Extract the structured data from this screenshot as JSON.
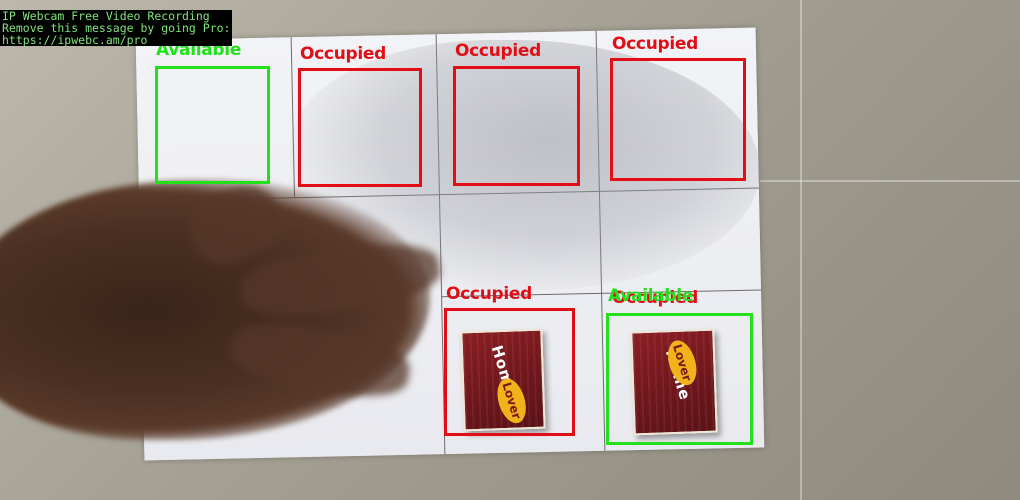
{
  "watermark": {
    "line1": "IP Webcam Free Video Recording",
    "line2": "Remove this message by going Pro:",
    "line3": "https://ipwebc.am/pro"
  },
  "slots": [
    {
      "id": "slot-1",
      "status": "available",
      "label": "Available"
    },
    {
      "id": "slot-2",
      "status": "occupied",
      "label": "Occupied"
    },
    {
      "id": "slot-3",
      "status": "occupied",
      "label": "Occupied"
    },
    {
      "id": "slot-4",
      "status": "occupied",
      "label": "Occupied"
    },
    {
      "id": "slot-5",
      "status": "occupied",
      "label": "Occupied"
    },
    {
      "id": "slot-6",
      "status": "available",
      "label": "Available",
      "overlap_label": "Occupied"
    }
  ],
  "products": [
    {
      "brand": "Home",
      "badge": "Lover"
    },
    {
      "brand": "Home",
      "badge": "Lover"
    }
  ],
  "colors": {
    "available": "#22e11b",
    "occupied": "#e10e16"
  }
}
